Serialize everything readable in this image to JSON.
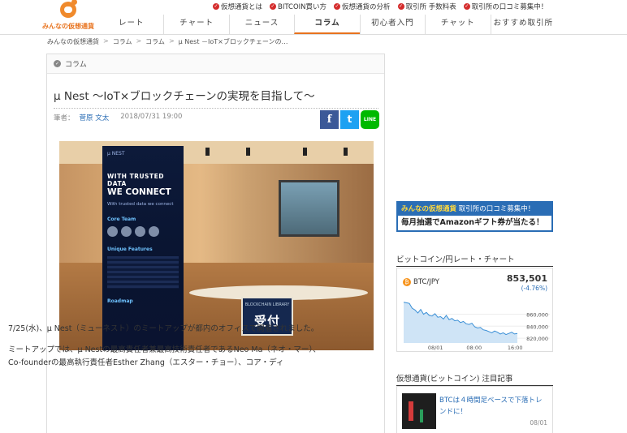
{
  "logo": {
    "text": "みんなの仮想通貨"
  },
  "top_links": [
    {
      "label": "仮想通貨とは"
    },
    {
      "label": "BITCOIN買い方"
    },
    {
      "label": "仮想通貨の分析"
    },
    {
      "label": "取引所 手数料表"
    },
    {
      "label": "取引所の口コミ募集中！"
    }
  ],
  "nav": [
    {
      "label": "レート"
    },
    {
      "label": "チャート"
    },
    {
      "label": "ニュース"
    },
    {
      "label": "コラム"
    },
    {
      "label": "初心者入門"
    },
    {
      "label": "チャット"
    },
    {
      "label": "おすすめ取引所"
    }
  ],
  "breadcrumb": [
    "みんなの仮想通貨",
    "コラム",
    "コラム",
    "μ Nest －IoT×ブロックチェーンの…"
  ],
  "breadcrumb_sep": ">",
  "article": {
    "category": "コラム",
    "title": "μ Nest ～IoT×ブロックチェーンの実現を目指して～",
    "author_label": "筆者：",
    "author": "菅原 文太",
    "date": "2018/07/31 19:00",
    "share": {
      "facebook": "f",
      "twitter": "t",
      "line": "LINE"
    },
    "photo": {
      "banner_logo": "μ NEST",
      "banner_h1": "WITH TRUSTED DATA",
      "banner_h2": "WE CONNECT",
      "banner_small": "With trusted data we connect",
      "banner_core": "Core Team",
      "banner_features": "Unique Features",
      "banner_roadmap": "Roadmap",
      "sign_top": "BLOCKCHAIN LIBRARY",
      "sign_main": "受付"
    },
    "paragraphs": [
      "7/25(水)、μ Nest（ミューネスト）のミートアップが都内のオフィスで開催されました。",
      "ミートアップでは、μ Nestの最高責任者兼最高技術責任者であるNeo Ma（ネオ・マー）、Co-founderの最高執行責任者Esther Zhang（エスター・チョー）、コア・ディ"
    ]
  },
  "sidebar": {
    "ad": {
      "brand": "みんなの仮想通貨",
      "top_text": "取引所の口コミ募集中！",
      "bottom_pre": "毎月抽選でAmazonギフト券が当たる！"
    },
    "chart_section_title": "ビットコイン/円レート・チャート",
    "news_section_title": "仮想通貨(ビットコイン) 注目記事",
    "news": [
      {
        "title": "BTCは４時間足ベースで下落トレンドに！",
        "date": "08/01"
      }
    ]
  },
  "chart_data": {
    "type": "area",
    "pair": "BTC/JPY",
    "price": "853,501",
    "change": "(-4.76%)",
    "color": "#3a8fd6",
    "x_ticks": [
      "08/01",
      "08:00",
      "16:00"
    ],
    "y_ticks": [
      860000,
      840000,
      820000
    ],
    "y_tick_labels": [
      "860,000",
      "840,000",
      "820,000"
    ],
    "ylim": [
      812000,
      885000
    ],
    "values": [
      880000,
      879000,
      878000,
      870000,
      867000,
      862000,
      868000,
      860000,
      863000,
      858000,
      857000,
      861000,
      855000,
      856000,
      852000,
      858000,
      851000,
      853000,
      849000,
      850000,
      846000,
      848000,
      844000,
      843000,
      845000,
      839000,
      837000,
      838000,
      834000,
      833000,
      831000,
      829000,
      832000,
      830000,
      827000,
      829000,
      826000,
      828000,
      830000,
      827000,
      828000
    ]
  }
}
